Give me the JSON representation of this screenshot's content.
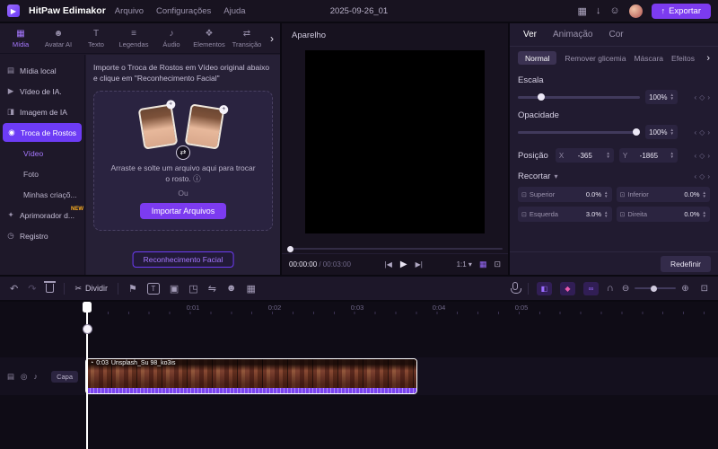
{
  "titlebar": {
    "app_name": "HitPaw Edimakor",
    "menus": [
      "Arquivo",
      "Configurações",
      "Ajuda"
    ],
    "project_name": "2025-09-26_01",
    "export_button": "Exportar"
  },
  "ribbon": {
    "tabs": [
      {
        "label": "Mídia",
        "glyph": "▦"
      },
      {
        "label": "Avatar AI",
        "glyph": "☻"
      },
      {
        "label": "Texto",
        "glyph": "T"
      },
      {
        "label": "Legendas",
        "glyph": "≡"
      },
      {
        "label": "Áudio",
        "glyph": "♪"
      },
      {
        "label": "Elementos",
        "glyph": "❖"
      },
      {
        "label": "Transição",
        "glyph": "⇄"
      }
    ]
  },
  "sidebar": {
    "items": [
      {
        "label": "Mídia local",
        "glyph": "▤"
      },
      {
        "label": "Vídeo de IA.",
        "glyph": "▶"
      },
      {
        "label": "Imagem de IA",
        "glyph": "◨"
      },
      {
        "label": "Troca de Rostos",
        "glyph": "◉"
      },
      {
        "label": "Vídeo"
      },
      {
        "label": "Foto"
      },
      {
        "label": "Minhas criaçõ..."
      },
      {
        "label": "Aprimorador d...",
        "glyph": "✦",
        "badge": "NEW"
      },
      {
        "label": "Registro",
        "glyph": "◷"
      }
    ]
  },
  "faceswap": {
    "instruction": "Importe o Troca de Rostos em Vídeo original abaixo e clique em \"Reconhecimento Facial\"",
    "drop_hint": "Arraste e solte um arquivo aqui para trocar o rosto.",
    "or_label": "Ou",
    "import_button": "Importar Arquivos",
    "recognize_button": "Reconhecimento Facial"
  },
  "preview": {
    "title": "Aparelho",
    "time_current": "00:00:00",
    "time_total": " / 00:03:00",
    "zoom_ratio": "1:1"
  },
  "properties": {
    "tabs": [
      "Ver",
      "Animação",
      "Cor"
    ],
    "subtabs": [
      "Normal",
      "Remover glicemia",
      "Máscara",
      "Efeitos"
    ],
    "scale": {
      "label": "Escala",
      "value": "100%"
    },
    "opacity": {
      "label": "Opacidade",
      "value": "100%"
    },
    "position": {
      "label": "Posição",
      "x_prefix": "X",
      "x_value": "-365",
      "y_prefix": "Y",
      "y_value": "-1865"
    },
    "crop": {
      "label": "Recortar",
      "fields": [
        {
          "label": "Superior",
          "value": "0.0%"
        },
        {
          "label": "Inferior",
          "value": "0.0%"
        },
        {
          "label": "Esquerda",
          "value": "3.0%"
        },
        {
          "label": "Direita",
          "value": "0.0%"
        }
      ]
    },
    "reset_button": "Redefinir"
  },
  "toolbar": {
    "split_label": "Dividir"
  },
  "timeline": {
    "ruler": [
      "0:01",
      "0:02",
      "0:03",
      "0:04",
      "0:05"
    ],
    "track_label": "Capa",
    "clip": {
      "duration": "0:03",
      "name": "Unsplash_Su 98_ko3is"
    }
  },
  "icons": {
    "logo": "▶",
    "workspace": "▦",
    "download": "↓",
    "support": "☺",
    "export_arrow": "↑",
    "chevron_right": "›",
    "info": "ⓘ",
    "swap": "⇄",
    "card_badge": "+",
    "prev_frame": "|◀",
    "play": "▶",
    "next_frame": "▶|",
    "caret_down": "▾",
    "grid": "▦",
    "fullscreen": "⊡",
    "undo": "↶",
    "redo": "↷",
    "scissors": "✂",
    "marker": "⚑",
    "text_tool": "T",
    "crop_tool": "▣",
    "pip_tool": "◳",
    "mirror_tool": "⇋",
    "face_tool": "☻",
    "sticker_tool": "▦",
    "chip_keyframe": "◧",
    "chip_record": "◆",
    "chip_link": "∞",
    "magnet": "∩",
    "zoom_out": "⊖",
    "zoom_in": "⊕",
    "fit": "⊡",
    "kf_prev": "‹",
    "kf_diamond": "◇",
    "kf_next": "›",
    "crop_corner": "⊡",
    "track_menu": "▤",
    "track_eye": "◎",
    "track_mute": "♪",
    "clip_clock": "◔"
  },
  "colors": {
    "accent": "#7c3bf0",
    "selected_pill": "#6d3cf5",
    "clip_strip": "#7b44f0"
  }
}
